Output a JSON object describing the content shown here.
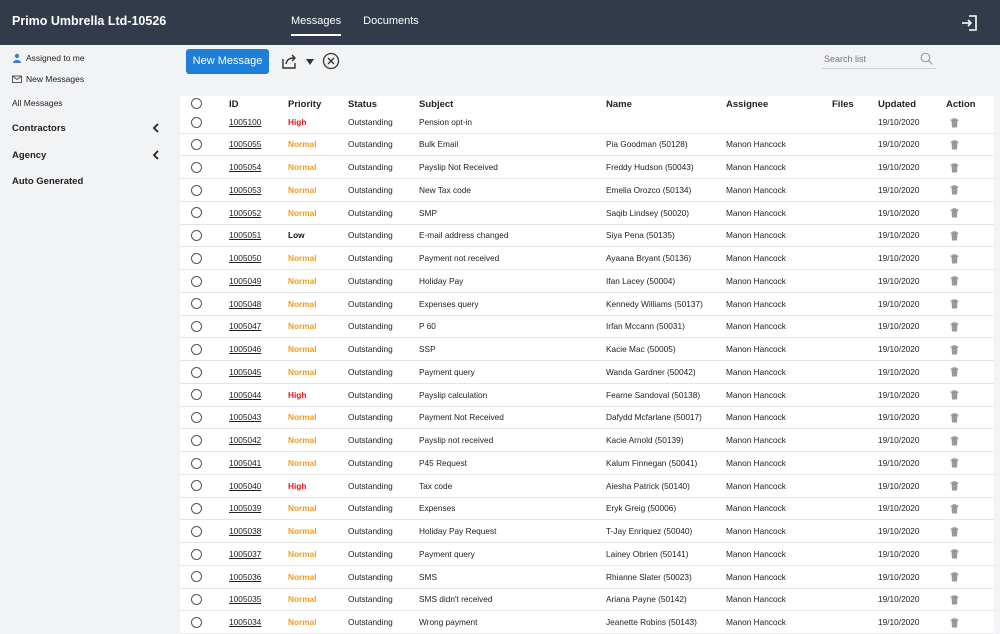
{
  "header": {
    "app_title": "Primo Umbrella Ltd-10526",
    "nav": [
      {
        "label": "Messages",
        "active": true
      },
      {
        "label": "Documents",
        "active": false
      }
    ],
    "logout_icon": "logout-icon"
  },
  "sidebar": {
    "items": [
      {
        "label": "Assigned to me",
        "icon": "user-icon"
      },
      {
        "label": "New Messages",
        "icon": "envelope-icon"
      },
      {
        "label": "All Messages",
        "icon": ""
      }
    ],
    "groups": [
      {
        "label": "Contractors",
        "icon": "chevron-left-icon"
      },
      {
        "label": "Agency",
        "icon": "chevron-left-icon"
      },
      {
        "label": "Auto Generated",
        "icon": ""
      }
    ]
  },
  "toolbar": {
    "new_message_label": "New Message",
    "search_placeholder": "Search list"
  },
  "table": {
    "columns": [
      "ID",
      "Priority",
      "Status",
      "Subject",
      "Name",
      "Assignee",
      "Files",
      "Updated",
      "Action"
    ],
    "rows": [
      {
        "id": "1005100",
        "priority": "High",
        "status": "Outstanding",
        "subject": "Pension opt-in",
        "name": "",
        "assignee": "",
        "files": "",
        "updated": "19/10/2020"
      },
      {
        "id": "1005055",
        "priority": "Normal",
        "status": "Outstanding",
        "subject": "Bulk Email",
        "name": "Pia Goodman (50128)",
        "assignee": "Manon Hancock",
        "files": "",
        "updated": "19/10/2020"
      },
      {
        "id": "1005054",
        "priority": "Normal",
        "status": "Outstanding",
        "subject": "Payslip Not Received",
        "name": "Freddy Hudson (50043)",
        "assignee": "Manon Hancock",
        "files": "",
        "updated": "19/10/2020"
      },
      {
        "id": "1005053",
        "priority": "Normal",
        "status": "Outstanding",
        "subject": "New Tax code",
        "name": "Emelia Orozco (50134)",
        "assignee": "Manon Hancock",
        "files": "",
        "updated": "19/10/2020"
      },
      {
        "id": "1005052",
        "priority": "Normal",
        "status": "Outstanding",
        "subject": "SMP",
        "name": "Saqib Lindsey (50020)",
        "assignee": "Manon Hancock",
        "files": "",
        "updated": "19/10/2020"
      },
      {
        "id": "1005051",
        "priority": "Low",
        "status": "Outstanding",
        "subject": "E-mail address changed",
        "name": "Siya Pena (50135)",
        "assignee": "Manon Hancock",
        "files": "",
        "updated": "19/10/2020"
      },
      {
        "id": "1005050",
        "priority": "Normal",
        "status": "Outstanding",
        "subject": "Payment not received",
        "name": "Ayaana Bryant (50136)",
        "assignee": "Manon Hancock",
        "files": "",
        "updated": "19/10/2020"
      },
      {
        "id": "1005049",
        "priority": "Normal",
        "status": "Outstanding",
        "subject": "Holiday Pay",
        "name": "Ifan Lacey (50004)",
        "assignee": "Manon Hancock",
        "files": "",
        "updated": "19/10/2020"
      },
      {
        "id": "1005048",
        "priority": "Normal",
        "status": "Outstanding",
        "subject": "Expenses query",
        "name": "Kennedy Williams (50137)",
        "assignee": "Manon Hancock",
        "files": "",
        "updated": "19/10/2020"
      },
      {
        "id": "1005047",
        "priority": "Normal",
        "status": "Outstanding",
        "subject": "P 60",
        "name": "Irfan Mccann (50031)",
        "assignee": "Manon Hancock",
        "files": "",
        "updated": "19/10/2020"
      },
      {
        "id": "1005046",
        "priority": "Normal",
        "status": "Outstanding",
        "subject": "SSP",
        "name": "Kacie Mac (50005)",
        "assignee": "Manon Hancock",
        "files": "",
        "updated": "19/10/2020"
      },
      {
        "id": "1005045",
        "priority": "Normal",
        "status": "Outstanding",
        "subject": "Payment query",
        "name": "Wanda Gardner (50042)",
        "assignee": "Manon Hancock",
        "files": "",
        "updated": "19/10/2020"
      },
      {
        "id": "1005044",
        "priority": "High",
        "status": "Outstanding",
        "subject": "Payslip calculation",
        "name": "Fearne Sandoval (50138)",
        "assignee": "Manon Hancock",
        "files": "",
        "updated": "19/10/2020"
      },
      {
        "id": "1005043",
        "priority": "Normal",
        "status": "Outstanding",
        "subject": "Payment Not Received",
        "name": "Dafydd Mcfarlane (50017)",
        "assignee": "Manon Hancock",
        "files": "",
        "updated": "19/10/2020"
      },
      {
        "id": "1005042",
        "priority": "Normal",
        "status": "Outstanding",
        "subject": "Payslip not received",
        "name": "Kacie Arnold (50139)",
        "assignee": "Manon Hancock",
        "files": "",
        "updated": "19/10/2020"
      },
      {
        "id": "1005041",
        "priority": "Normal",
        "status": "Outstanding",
        "subject": "P45 Request",
        "name": "Kalum Finnegan (50041)",
        "assignee": "Manon Hancock",
        "files": "",
        "updated": "19/10/2020"
      },
      {
        "id": "1005040",
        "priority": "High",
        "status": "Outstanding",
        "subject": "Tax code",
        "name": "Aiesha Patrick (50140)",
        "assignee": "Manon Hancock",
        "files": "",
        "updated": "19/10/2020"
      },
      {
        "id": "1005039",
        "priority": "Normal",
        "status": "Outstanding",
        "subject": "Expenses",
        "name": "Eryk Greig (50006)",
        "assignee": "Manon Hancock",
        "files": "",
        "updated": "19/10/2020"
      },
      {
        "id": "1005038",
        "priority": "Normal",
        "status": "Outstanding",
        "subject": "Holiday Pay Request",
        "name": "T-Jay Enriquez (50040)",
        "assignee": "Manon Hancock",
        "files": "",
        "updated": "19/10/2020"
      },
      {
        "id": "1005037",
        "priority": "Normal",
        "status": "Outstanding",
        "subject": "Payment query",
        "name": "Lainey Obrien (50141)",
        "assignee": "Manon Hancock",
        "files": "",
        "updated": "19/10/2020"
      },
      {
        "id": "1005036",
        "priority": "Normal",
        "status": "Outstanding",
        "subject": "SMS",
        "name": "Rhianne Slater (50023)",
        "assignee": "Manon Hancock",
        "files": "",
        "updated": "19/10/2020"
      },
      {
        "id": "1005035",
        "priority": "Normal",
        "status": "Outstanding",
        "subject": "SMS didn't received",
        "name": "Ariana Payne (50142)",
        "assignee": "Manon Hancock",
        "files": "",
        "updated": "19/10/2020"
      },
      {
        "id": "1005034",
        "priority": "Normal",
        "status": "Outstanding",
        "subject": "Wrong payment",
        "name": "Jeanette Robins (50143)",
        "assignee": "Manon Hancock",
        "files": "",
        "updated": "19/10/2020"
      }
    ]
  },
  "colors": {
    "topbar": "#323b4a",
    "primary_button": "#1f7fd8",
    "priority_high": "#e11b1b",
    "priority_normal": "#f29b1f",
    "priority_low": "#111111"
  }
}
